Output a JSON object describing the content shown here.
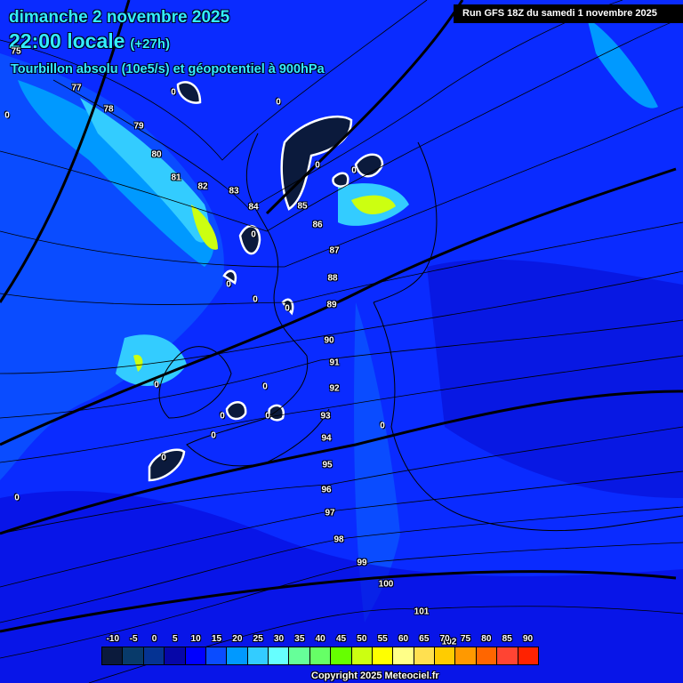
{
  "header": {
    "date": "dimanche 2 novembre 2025",
    "time": "22:00 locale",
    "forecast_offset": "(+27h)",
    "subtitle": "Tourbillon absolu (10e5/s) et géopotentiel à 900hPa",
    "run": "Run GFS 18Z du samedi 1 novembre 2025"
  },
  "contour_labels": [
    "75",
    "77",
    "78",
    "79",
    "80",
    "81",
    "82",
    "83",
    "84",
    "85",
    "86",
    "87",
    "88",
    "89",
    "90",
    "91",
    "92",
    "93",
    "94",
    "95",
    "96",
    "97",
    "98",
    "99",
    "100",
    "101",
    "102"
  ],
  "zero_label": "0",
  "legend": {
    "labels": [
      "-10",
      "-5",
      "0",
      "5",
      "10",
      "15",
      "20",
      "25",
      "30",
      "35",
      "40",
      "45",
      "50",
      "55",
      "60",
      "65",
      "70",
      "75",
      "80",
      "85",
      "90"
    ],
    "colors": [
      "#0b1a3c",
      "#083a6a",
      "#053393",
      "#0606a8",
      "#0000ff",
      "#0a4cff",
      "#0099ff",
      "#33ccff",
      "#66ffff",
      "#66ff99",
      "#66ff66",
      "#66ff00",
      "#ccff11",
      "#ffff00",
      "#ffff88",
      "#ffe050",
      "#ffcc00",
      "#ff9900",
      "#ff6600",
      "#ff4433",
      "#ff2200"
    ]
  },
  "copyright": "Copyright 2025 Meteociel.fr"
}
